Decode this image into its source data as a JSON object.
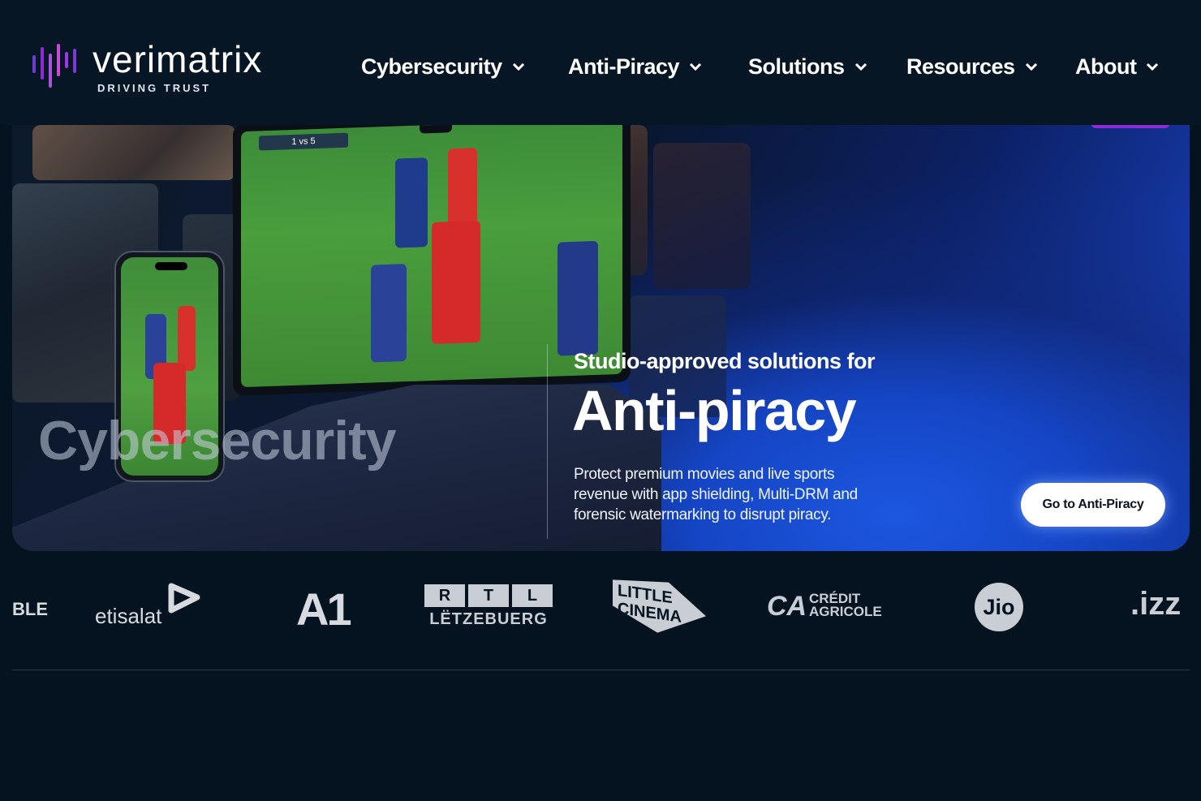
{
  "brand": {
    "name": "verimatrix",
    "tagline": "DRIVING TRUST",
    "accent_colors": [
      "#8d2bd6",
      "#b14fe3",
      "#6a3fd0"
    ]
  },
  "nav": {
    "items": [
      {
        "label": "Cybersecurity",
        "icon": "chevron-down-icon"
      },
      {
        "label": "Anti-Piracy",
        "icon": "chevron-down-icon"
      },
      {
        "label": "Solutions",
        "icon": "chevron-down-icon"
      },
      {
        "label": "Resources",
        "icon": "chevron-down-icon"
      },
      {
        "label": "About",
        "icon": "chevron-down-icon"
      }
    ]
  },
  "hero": {
    "ghost_label": "Cybersecurity",
    "eyebrow": "Studio-approved solutions for",
    "headline": "Anti-piracy",
    "description": "Protect premium movies and live sports revenue with app shielding, Multi-DRM and forensic watermarking to disrupt piracy.",
    "cta_label": "Go to Anti-Piracy",
    "background_color": "#1a48d0",
    "scoreboard": "1 vs 5"
  },
  "partners": {
    "items": [
      {
        "name": "BLE"
      },
      {
        "name": "etisalat"
      },
      {
        "name": "A1"
      },
      {
        "name": "RTL LËTZEBUERG"
      },
      {
        "name": "LITTLE CINEMA"
      },
      {
        "name": "CRÉDIT AGRICOLE"
      },
      {
        "name": "Jio"
      },
      {
        "name": ".izz"
      }
    ]
  }
}
